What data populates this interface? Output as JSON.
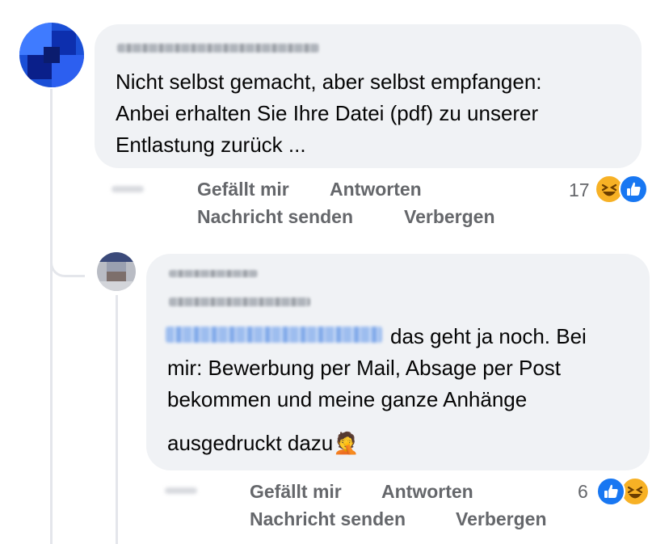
{
  "comments": [
    {
      "text_line1": "Nicht selbst gemacht, aber selbst empfangen:",
      "text_line2": "Anbei erhalten Sie Ihre Datei (pdf) zu unserer",
      "text_line3": "Entlastung zurück ...",
      "actions": {
        "like": "Gefällt mir",
        "reply": "Antworten",
        "message": "Nachricht senden",
        "hide": "Verbergen"
      },
      "reaction_count": "17",
      "reactions": [
        "haha",
        "like"
      ]
    },
    {
      "text_line1": "das geht ja noch. Bei",
      "text_line2": "mir: Bewerbung per Mail, Absage per Post",
      "text_line3": "bekommen und meine ganze Anhänge",
      "text_line4": "ausgedruckt dazu",
      "emoji": "🤦",
      "actions": {
        "like": "Gefällt mir",
        "reply": "Antworten",
        "message": "Nachricht senden",
        "hide": "Verbergen"
      },
      "reaction_count": "6",
      "reactions": [
        "like",
        "haha"
      ]
    }
  ],
  "colors": {
    "bubble": "#f0f2f5",
    "action_text": "#65676b",
    "like_blue": "#1877f2",
    "haha_yellow": "#f7b125"
  }
}
